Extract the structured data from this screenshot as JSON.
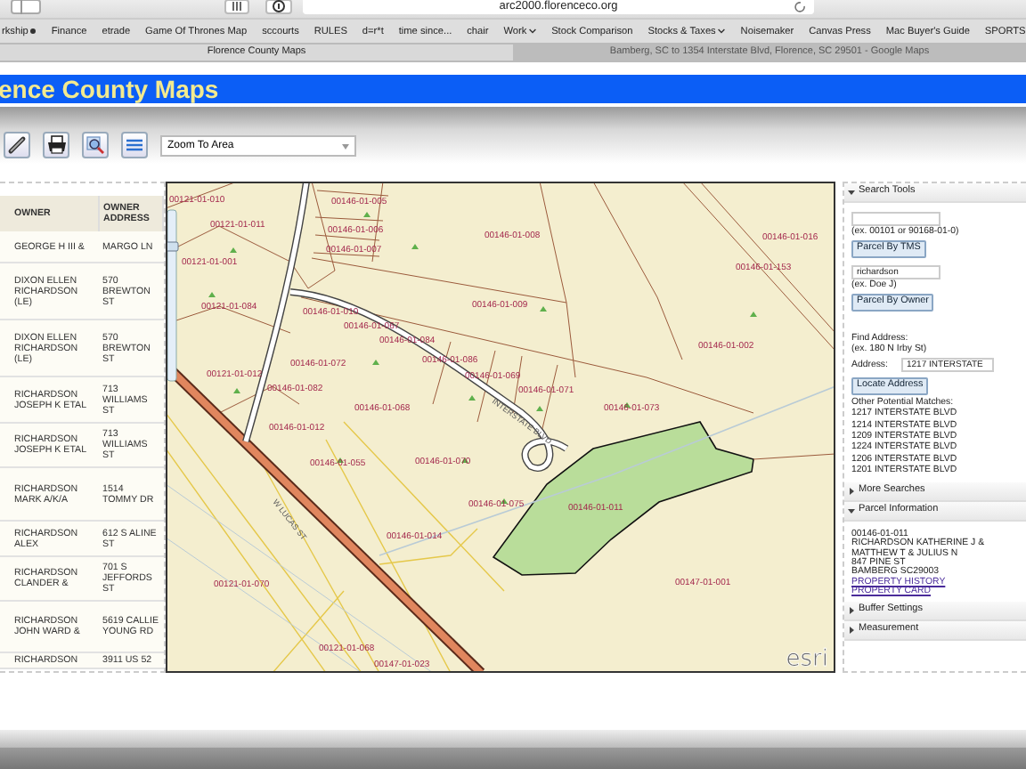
{
  "browser": {
    "address": "arc2000.florenceco.org",
    "bookmarks": [
      {
        "label": "rkship",
        "kind": "marked"
      },
      {
        "label": "Finance",
        "kind": "link"
      },
      {
        "label": "etrade",
        "kind": "link"
      },
      {
        "label": "Game Of Thrones Map",
        "kind": "link"
      },
      {
        "label": "sccourts",
        "kind": "link"
      },
      {
        "label": "RULES",
        "kind": "link"
      },
      {
        "label": "d=r*t",
        "kind": "link"
      },
      {
        "label": "time since...",
        "kind": "link"
      },
      {
        "label": "chair",
        "kind": "link"
      },
      {
        "label": "Work",
        "kind": "menu"
      },
      {
        "label": "Stock Comparison",
        "kind": "link"
      },
      {
        "label": "Stocks & Taxes",
        "kind": "menu"
      },
      {
        "label": "Noisemaker",
        "kind": "link"
      },
      {
        "label": "Canvas Press",
        "kind": "link"
      },
      {
        "label": "Mac Buyer's Guide",
        "kind": "link"
      },
      {
        "label": "SPORTS",
        "kind": "link"
      }
    ],
    "tabs": [
      {
        "label": "Florence County Maps",
        "selected": true
      },
      {
        "label": "Bamberg, SC to 1354 Interstate Blvd, Florence, SC 29501 - Google Maps",
        "selected": false
      }
    ]
  },
  "header": {
    "title": "ence County Maps"
  },
  "toolbar": {
    "select": {
      "value": "Zoom To Area"
    }
  },
  "results_table": {
    "columns": [
      "OWNER",
      "OWNER ADDRESS"
    ],
    "rows": [
      {
        "owner": "GEORGE H III &",
        "address": "MARGO LN"
      },
      {
        "owner": "DIXON ELLEN RICHARDSON (LE)",
        "address": "570 BREWTON ST"
      },
      {
        "owner": "DIXON ELLEN RICHARDSON (LE)",
        "address": "570 BREWTON ST"
      },
      {
        "owner": "RICHARDSON JOSEPH K ETAL",
        "address": "713 WILLIAMS ST"
      },
      {
        "owner": "RICHARDSON JOSEPH K ETAL",
        "address": "713 WILLIAMS ST"
      },
      {
        "owner": "RICHARDSON MARK A/K/A",
        "address": "1514 TOMMY DR"
      },
      {
        "owner": "RICHARDSON ALEX",
        "address": "612 S ALINE ST"
      },
      {
        "owner": "RICHARDSON CLANDER &",
        "address": "701 S JEFFORDS ST"
      },
      {
        "owner": "RICHARDSON JOHN WARD &",
        "address": "5619 CALLIE YOUNG RD"
      },
      {
        "owner": "RICHARDSON",
        "address": "3911 US 52"
      }
    ]
  },
  "map": {
    "zoom_slider": {
      "level": 0.8
    },
    "parcels": [
      "00121-01-010",
      "00146-01-005",
      "00121-01-011",
      "00146-01-006",
      "00146-01-008",
      "00146-01-016",
      "00146-01-007",
      "00121-01-001",
      "00146-01-153",
      "00121-01-084",
      "00146-01-009",
      "00146-01-010",
      "00146-01-067",
      "00146-01-084",
      "00146-01-002",
      "00146-01-072",
      "00146-01-086",
      "00121-01-012",
      "00146-01-069",
      "00146-01-082",
      "00146-01-071",
      "00146-01-068",
      "00146-01-073",
      "00146-01-012",
      "00146-01-055",
      "00146-01-070",
      "00146-01-075",
      "00146-01-011",
      "00146-01-014",
      "00121-01-070",
      "00147-01-001",
      "00121-01-068",
      "00147-01-023"
    ],
    "streets": [
      "W LUCAS ST",
      "INTERSTATE BLVD"
    ],
    "logo": "esri"
  },
  "panels": [
    {
      "kind": "search",
      "title": "Search Tools",
      "expanded": true,
      "tms_example": "(ex. 00101 or 90168-01-0)",
      "tms_button": "Parcel By TMS",
      "owner_value": "richardson",
      "owner_example": "(ex. Doe J)",
      "owner_button": "Parcel By Owner",
      "find_label": "Find Address:",
      "find_example": "(ex. 180 N Irby St)",
      "address_label": "Address:",
      "address_value": "1217 INTERSTATE",
      "locate_button": "Locate Address",
      "matches_label": "Other Potential Matches:",
      "matches": [
        "1217 INTERSTATE BLVD",
        "1214 INTERSTATE BLVD",
        "1209 INTERSTATE BLVD",
        "1224 INTERSTATE BLVD",
        "1206 INTERSTATE BLVD",
        "1201 INTERSTATE BLVD"
      ]
    },
    {
      "kind": "plain",
      "title": "More Searches",
      "expanded": false
    },
    {
      "kind": "parcel",
      "title": "Parcel Information",
      "expanded": true,
      "lines": [
        "00146-01-011",
        "RICHARDSON KATHERINE J &",
        "MATTHEW T & JULIUS N",
        "847 PINE ST",
        "BAMBERG SC29003"
      ],
      "links": [
        "PROPERTY HISTORY",
        "PROPERTY CARD"
      ]
    },
    {
      "kind": "plain",
      "title": "Buffer Settings",
      "expanded": false
    },
    {
      "kind": "plain",
      "title": "Measurement",
      "expanded": false
    }
  ]
}
